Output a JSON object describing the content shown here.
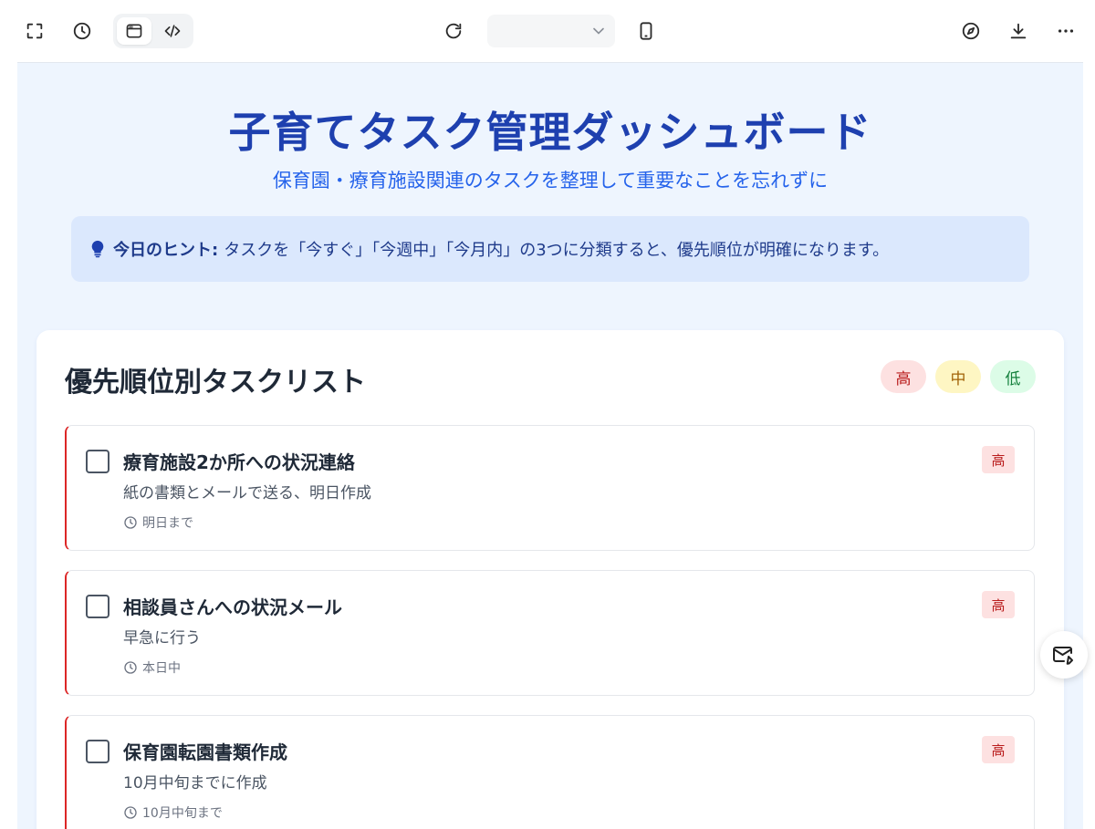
{
  "toolbar": {
    "left_icons": [
      "fullscreen-icon",
      "history-icon"
    ],
    "view_toggle": [
      "preview-icon",
      "code-icon"
    ],
    "center_icons": [
      "refresh-icon",
      "mobile-device-icon"
    ],
    "url_select_value": "",
    "right_icons": [
      "compass-icon",
      "download-icon",
      "more-icon"
    ]
  },
  "page": {
    "title": "子育てタスク管理ダッシュボード",
    "subtitle": "保育園・療育施設関連のタスクを整理して重要なことを忘れずに",
    "tip": {
      "label": "今日のヒント:",
      "text": "タスクを「今すぐ」「今週中」「今月内」の3つに分類すると、優先順位が明確になります。"
    }
  },
  "tasklist": {
    "title": "優先順位別タスクリスト",
    "legend": {
      "high": "高",
      "mid": "中",
      "low": "低"
    },
    "tasks": [
      {
        "title": "療育施設2か所への状況連絡",
        "desc": "紙の書類とメールで送る、明日作成",
        "due": "明日まで",
        "priority": "高"
      },
      {
        "title": "相談員さんへの状況メール",
        "desc": "早急に行う",
        "due": "本日中",
        "priority": "高"
      },
      {
        "title": "保育園転園書類作成",
        "desc": "10月中旬までに作成",
        "due": "10月中旬まで",
        "priority": "高"
      }
    ]
  },
  "colors": {
    "accent": "#1e40af",
    "high": "#dc2626",
    "mid": "#ca8a04",
    "low": "#16a34a",
    "background": "#eef5fe"
  }
}
